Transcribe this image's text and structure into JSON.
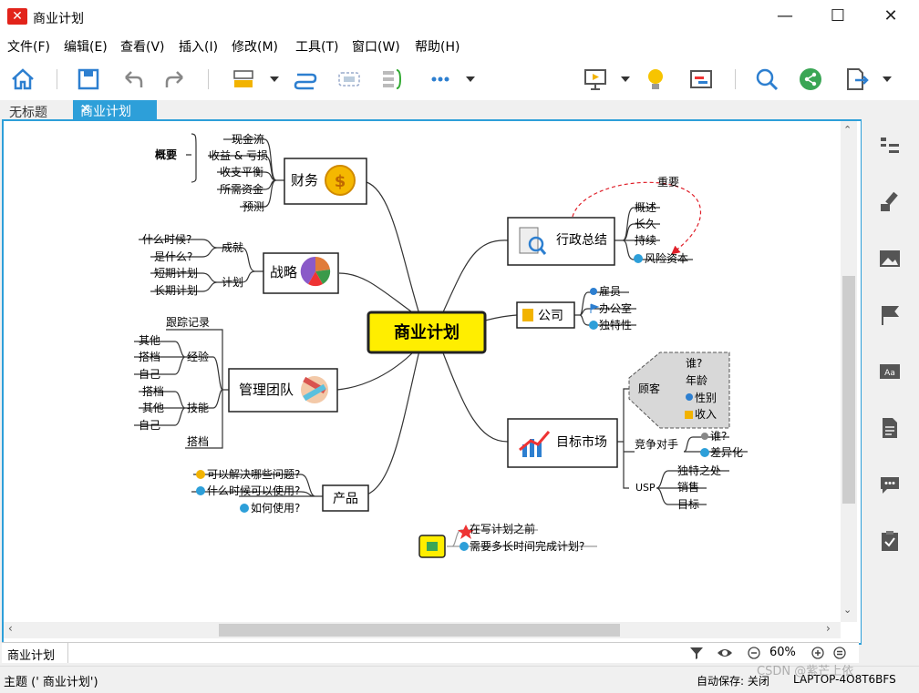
{
  "window": {
    "title": "商业计划",
    "minimize": "—",
    "maximize": "☐",
    "close": "✕"
  },
  "menu": [
    "文件(F)",
    "编辑(E)",
    "查看(V)",
    "插入(I)",
    "修改(M)",
    "工具(T)",
    "窗口(W)",
    "帮助(H)"
  ],
  "tabs": {
    "untitled": "无标题",
    "active": "商业计划",
    "close": "✕"
  },
  "map": {
    "central": "商业计划",
    "finance": {
      "label": "财务",
      "summary": "概要",
      "items": [
        "现金流",
        "收益 & 亏损",
        "收支平衡",
        "所需资金",
        "预测"
      ]
    },
    "strategy": {
      "label": "战略",
      "achievement": "成就",
      "plan": "计划",
      "items": [
        "什么时候?",
        "是什么?",
        "短期计划",
        "长期计划"
      ]
    },
    "team": {
      "label": "管理团队",
      "track": "跟踪记录",
      "experience": "经验",
      "skills": "技能",
      "partner": "搭档",
      "exp_items": [
        "其他",
        "搭档",
        "自己"
      ],
      "skill_items": [
        "搭档",
        "其他",
        "自己"
      ]
    },
    "product": {
      "label": "产品",
      "items": [
        "可以解决哪些问题?",
        "什么时候可以使用?",
        "如何使用?"
      ]
    },
    "admin": {
      "label": "行政总结",
      "relation": "重要",
      "items": [
        "概述",
        "长久",
        "持续",
        "风险资本"
      ]
    },
    "company": {
      "label": "公司",
      "items": [
        "雇员",
        "办公室",
        "独特性"
      ]
    },
    "market": {
      "label": "目标市场",
      "customer": "顾客",
      "cust_items": [
        "谁?",
        "年龄",
        "性别",
        "收入"
      ],
      "competitor": "竞争对手",
      "comp_items": [
        "谁?",
        "差异化"
      ],
      "usp": "USP",
      "usp_items": [
        "独特之处",
        "销售",
        "目标"
      ]
    },
    "floating": {
      "items": [
        "在写计划之前",
        "需要多长时间完成计划?"
      ]
    }
  },
  "filterbar": {
    "sheet": "商业计划",
    "zoom": "60%"
  },
  "status": {
    "topic": "主题 (' 商业计划')",
    "autosave": "自动保存: 关闭",
    "machine": "LAPTOP-4O8T6BFS",
    "watermark": "CSDN @紫芒上依"
  },
  "colors": {
    "accent": "#2d9fd9",
    "central_fill": "#ffee00",
    "central_border": "#222222",
    "relation": "#e0202a"
  }
}
